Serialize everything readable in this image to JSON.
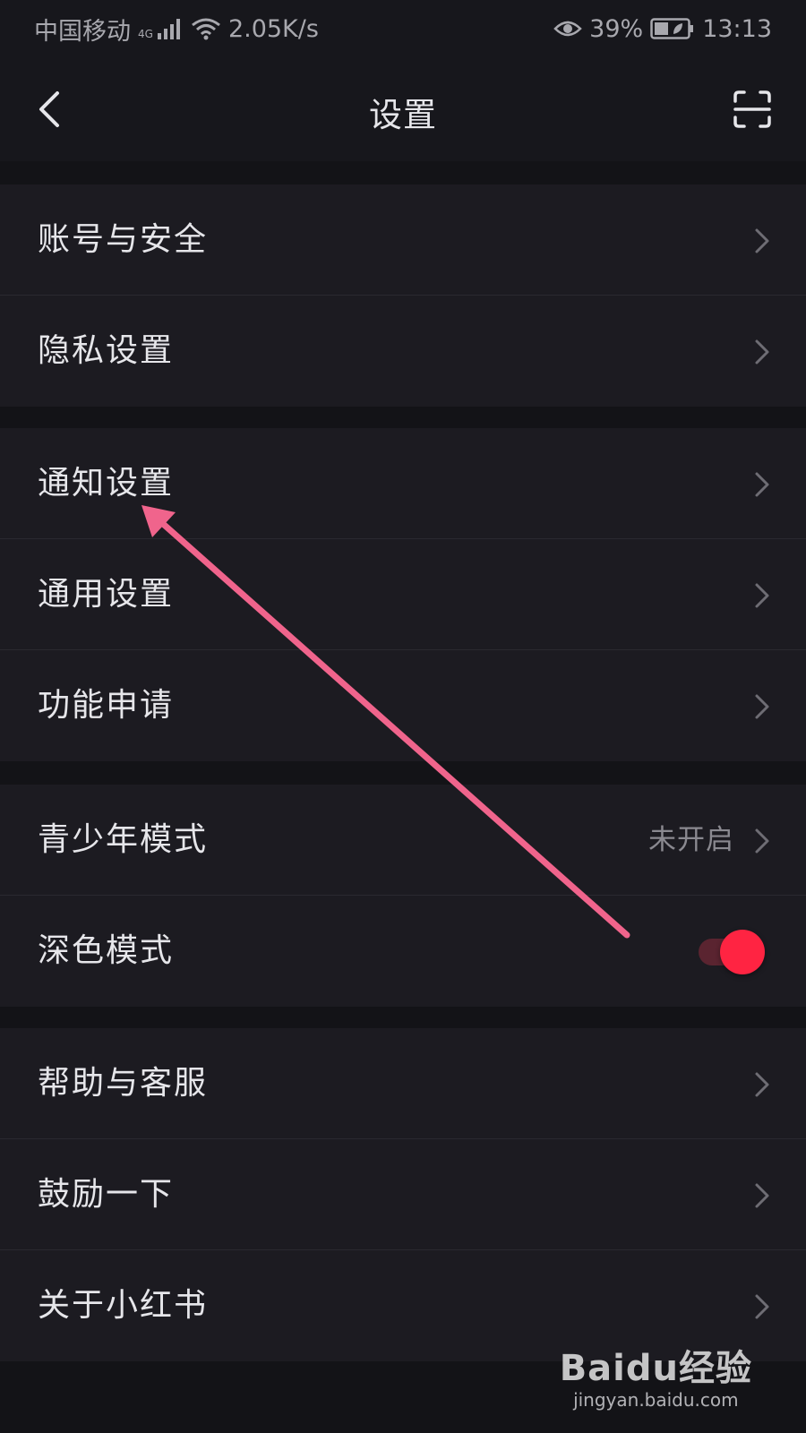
{
  "status_bar": {
    "carrier": "中国移动",
    "network": "4G",
    "speed": "2.05K/s",
    "battery": "39%",
    "time": "13:13"
  },
  "nav": {
    "title": "设置",
    "back_icon": "chevron-left-icon",
    "scan_icon": "scan-icon"
  },
  "groups": [
    {
      "items": [
        {
          "label": "账号与安全"
        },
        {
          "label": "隐私设置"
        }
      ]
    },
    {
      "items": [
        {
          "label": "通知设置"
        },
        {
          "label": "通用设置"
        },
        {
          "label": "功能申请"
        }
      ]
    },
    {
      "items": [
        {
          "label": "青少年模式",
          "value": "未开启"
        },
        {
          "label": "深色模式",
          "toggle": true
        }
      ]
    },
    {
      "items": [
        {
          "label": "帮助与客服"
        },
        {
          "label": "鼓励一下"
        },
        {
          "label": "关于小红书"
        }
      ]
    }
  ],
  "colors": {
    "background": "#131317",
    "row_background": "#1c1b21",
    "accent": "#ff2442",
    "arrow": "#f0648c"
  },
  "watermark": {
    "logo": "Baidu经验",
    "url": "jingyan.baidu.com"
  }
}
